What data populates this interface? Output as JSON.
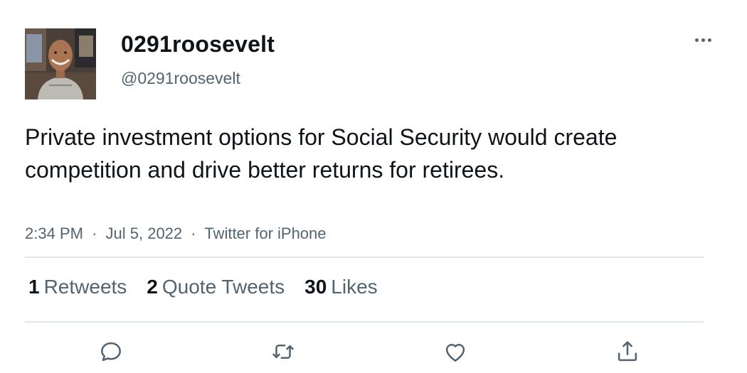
{
  "author": {
    "display_name": "0291roosevelt",
    "handle": "@0291roosevelt",
    "avatar_icon": "avatar-photo"
  },
  "tweet": {
    "text": "Private investment options for Social Security would create competition and drive better returns for retirees.",
    "time": "2:34 PM",
    "date": "Jul 5, 2022",
    "source": "Twitter for iPhone",
    "separator": "·"
  },
  "stats": [
    {
      "count": "1",
      "label": "Retweets"
    },
    {
      "count": "2",
      "label": "Quote Tweets"
    },
    {
      "count": "30",
      "label": "Likes"
    }
  ],
  "actions": {
    "reply_icon": "reply-icon",
    "retweet_icon": "retweet-icon",
    "like_icon": "heart-icon",
    "share_icon": "share-icon"
  },
  "colors": {
    "text_primary": "#0f1419",
    "text_secondary": "#536471",
    "divider": "#e1e6ea"
  }
}
